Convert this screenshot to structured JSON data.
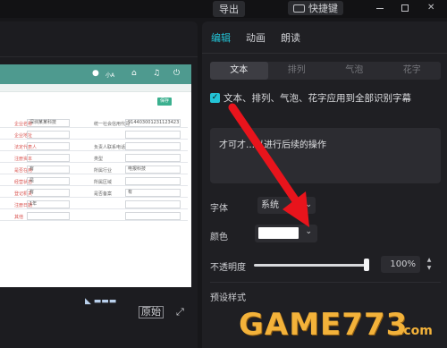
{
  "topbar": {
    "export_label": "导出",
    "shortcut_label": "快捷键"
  },
  "preview": {
    "original_button": "原始",
    "app_bar_user": "小A",
    "form_button": "保存",
    "form_rows": [
      {
        "label": "企业名称",
        "value": "深圳某某科技",
        "label2": "统一社会信用代码",
        "value2": "914403001231123423"
      },
      {
        "label": "企业地址",
        "value": "",
        "label2": "",
        "value2": ""
      },
      {
        "label": "法定代表人",
        "value": "",
        "label2": "负责人联系电话",
        "value2": ""
      },
      {
        "label": "注册资本",
        "value": "",
        "label2": "类型",
        "value2": ""
      },
      {
        "label": "是否在用",
        "value": "有",
        "label2": "所属行业",
        "value2": "电报科技"
      },
      {
        "label": "经营状态",
        "value": "是",
        "label2": "所属区域",
        "value2": ""
      },
      {
        "label": "登记机关",
        "value": "有",
        "label2": "是否备案",
        "value2": "有"
      },
      {
        "label": "注册日期",
        "value": "1年",
        "label2": "",
        "value2": ""
      },
      {
        "label": "其他",
        "value": "",
        "label2": "",
        "value2": ""
      }
    ]
  },
  "panel": {
    "tabs": [
      "编辑",
      "动画",
      "朗读"
    ],
    "segments": [
      "文本",
      "排列",
      "气泡",
      "花字"
    ],
    "apply_all_label": "文本、排列、气泡、花字应用到全部识别字幕",
    "text_content": "才可才…以进行后续的操作",
    "font_label": "字体",
    "font_value": "系统",
    "color_label": "颜色",
    "color_value": "#ffffff",
    "opacity_label": "不透明度",
    "opacity_value": "100%",
    "opacity_fraction": 1.0,
    "preset_label": "预设样式"
  },
  "watermark": {
    "brand": "GAME773",
    "domain": ".com"
  },
  "colors": {
    "accent": "#23c3d6",
    "arrow": "#e8141c",
    "app_bar": "#4e9a8f"
  }
}
